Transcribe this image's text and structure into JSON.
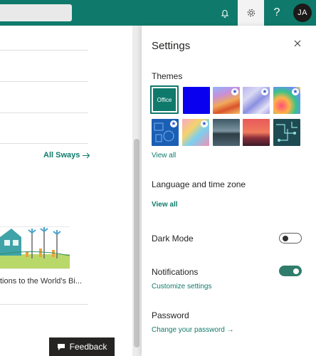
{
  "topbar": {
    "search_placeholder": "",
    "bell_icon": "bell-icon",
    "gear_icon": "gear-icon",
    "help_label": "?",
    "avatar_initials": "JA"
  },
  "left": {
    "all_sways_label": "All Sways",
    "card_title": "tions to the World's Bi..."
  },
  "settings": {
    "title": "Settings",
    "themes_label": "Themes",
    "office_theme_label": "Office",
    "view_all_themes": "View all",
    "language_label": "Language and time zone",
    "view_all_language": "View all",
    "dark_mode_label": "Dark Mode",
    "dark_mode_on": false,
    "notifications_label": "Notifications",
    "notifications_on": true,
    "customize_settings": "Customize settings",
    "password_label": "Password",
    "change_password": "Change your password →"
  },
  "feedback": {
    "label": "Feedback"
  },
  "colors": {
    "accent": "#0f7a6b",
    "topbar": "#0f7a6b"
  }
}
